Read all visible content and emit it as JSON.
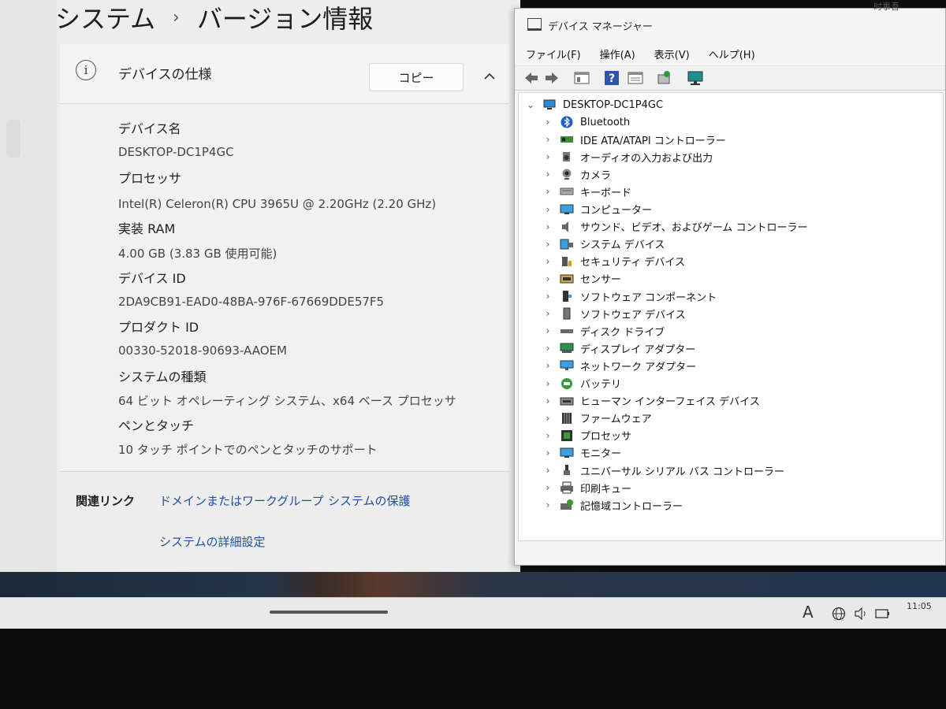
{
  "settings": {
    "breadcrumb": {
      "parent": "システム",
      "current": "バージョン情報"
    },
    "device_specs": {
      "title": "デバイスの仕様",
      "copy_label": "コピー",
      "fields": [
        {
          "label": "デバイス名",
          "value": "DESKTOP-DC1P4GC"
        },
        {
          "label": "プロセッサ",
          "value": "Intel(R) Celeron(R) CPU 3965U @ 2.20GHz (2.20 GHz)"
        },
        {
          "label": "実装 RAM",
          "value": "4.00 GB (3.83 GB 使用可能)"
        },
        {
          "label": "デバイス ID",
          "value": "2DA9CB91-EAD0-48BA-976F-67669DDE57F5"
        },
        {
          "label": "プロダクト ID",
          "value": "00330-52018-90693-AAOEM"
        },
        {
          "label": "システムの種類",
          "value": "64 ビット オペレーティング システム、x64 ベース プロセッサ"
        },
        {
          "label": "ペンとタッチ",
          "value": "10 タッチ ポイントでのペンとタッチのサポート"
        }
      ]
    },
    "related_links": {
      "label": "関連リンク",
      "links": [
        "ドメインまたはワークグループ",
        "システムの保護",
        "システムの詳細設定"
      ]
    }
  },
  "device_manager": {
    "title": "デバイス マネージャー",
    "menu": [
      "ファイル(F)",
      "操作(A)",
      "表示(V)",
      "ヘルプ(H)"
    ],
    "root": "DESKTOP-DC1P4GC",
    "categories": [
      {
        "label": "Bluetooth",
        "icon": "bluetooth-icon"
      },
      {
        "label": "IDE ATA/ATAPI コントローラー",
        "icon": "ide-controller-icon"
      },
      {
        "label": "オーディオの入力および出力",
        "icon": "audio-icon"
      },
      {
        "label": "カメラ",
        "icon": "camera-icon"
      },
      {
        "label": "キーボード",
        "icon": "keyboard-icon"
      },
      {
        "label": "コンピューター",
        "icon": "computer-icon"
      },
      {
        "label": "サウンド、ビデオ、およびゲーム コントローラー",
        "icon": "sound-icon"
      },
      {
        "label": "システム デバイス",
        "icon": "system-device-icon"
      },
      {
        "label": "セキュリティ デバイス",
        "icon": "security-device-icon"
      },
      {
        "label": "センサー",
        "icon": "sensor-icon"
      },
      {
        "label": "ソフトウェア コンポーネント",
        "icon": "software-component-icon"
      },
      {
        "label": "ソフトウェア デバイス",
        "icon": "software-device-icon"
      },
      {
        "label": "ディスク ドライブ",
        "icon": "disk-drive-icon"
      },
      {
        "label": "ディスプレイ アダプター",
        "icon": "display-adapter-icon"
      },
      {
        "label": "ネットワーク アダプター",
        "icon": "network-adapter-icon"
      },
      {
        "label": "バッテリ",
        "icon": "battery-icon"
      },
      {
        "label": "ヒューマン インターフェイス デバイス",
        "icon": "hid-icon"
      },
      {
        "label": "ファームウェア",
        "icon": "firmware-icon"
      },
      {
        "label": "プロセッサ",
        "icon": "processor-icon"
      },
      {
        "label": "モニター",
        "icon": "monitor-icon"
      },
      {
        "label": "ユニバーサル シリアル バス コントローラー",
        "icon": "usb-icon"
      },
      {
        "label": "印刷キュー",
        "icon": "printer-icon"
      },
      {
        "label": "記憶域コントローラー",
        "icon": "storage-controller-icon"
      }
    ]
  },
  "taskbar": {
    "ime_indicator": "A",
    "clock": "11:05"
  },
  "top_right_text": "时事吾"
}
